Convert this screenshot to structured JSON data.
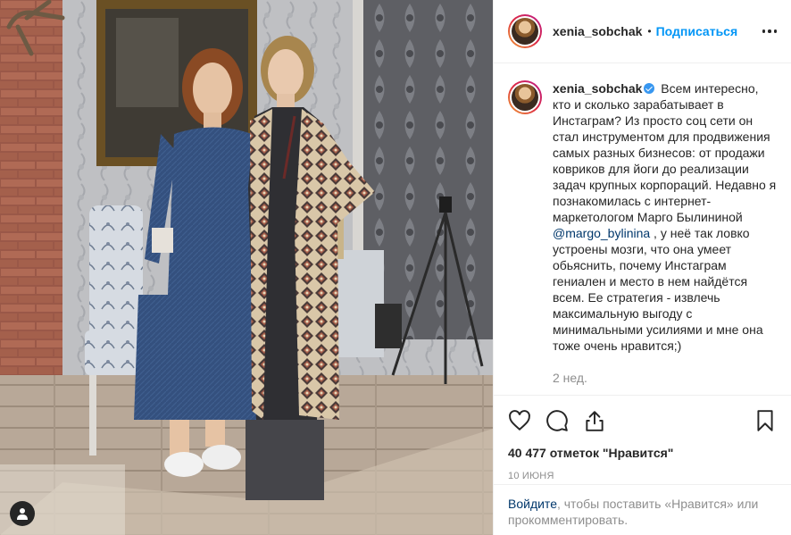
{
  "post": {
    "username": "xenia_sobchak",
    "dot": "•",
    "follow_label": "Подписаться",
    "caption": {
      "before_mention": "Всем интересно, кто и сколько зарабатывает в Инстаграм? Из просто соц сети он стал инструментом для продвижения самых разных бизнесов: от продажи ковриков для йоги до реализации задач крупных корпораций. Недавно я познакомилась с интернет-маркетологом Марго Былининой",
      "mention": "@margo_bylinina",
      "after_mention": ", у неё так ловко устроены мозги, что она умеет обьяснить, почему Инстаграм гениален и место в нем найдётся всем. Ее стратегия - извлечь максимальную выгоду с минимальными усилиями и мне она тоже очень нравится;)"
    },
    "time_ago": "2 нед.",
    "likes": "40 477 отметок \"Нравится\"",
    "date": "10 ИЮНЯ",
    "login_link": "Войдите",
    "login_text": ", чтобы поставить «Нравится» или прокомментировать."
  },
  "icons": {
    "like": "heart-icon",
    "comment": "comment-icon",
    "share": "share-icon",
    "save": "bookmark-icon",
    "tags": "user-tag-icon",
    "more": "more-icon"
  },
  "colors": {
    "link": "#00376b",
    "follow": "#0095f6",
    "verified": "#3897f0",
    "muted": "#8e8e8e"
  }
}
